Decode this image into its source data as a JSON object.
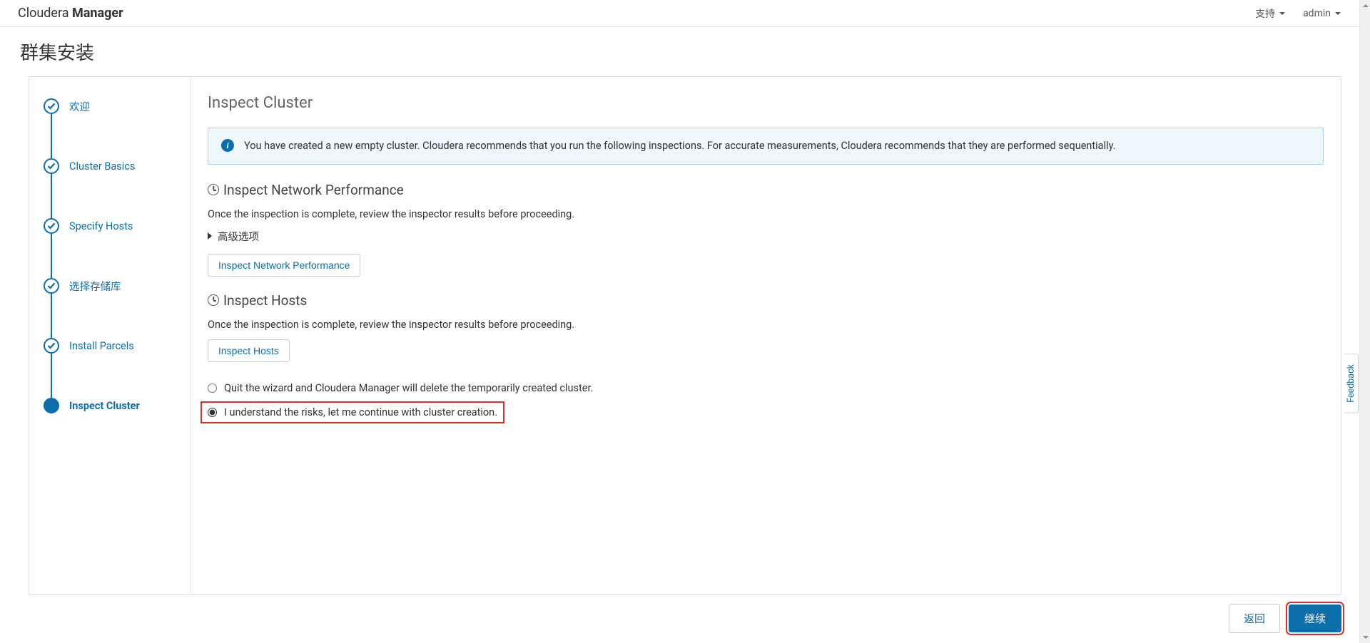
{
  "header": {
    "brand_light": "Cloudera ",
    "brand_bold": "Manager",
    "support": "支持",
    "user": "admin"
  },
  "page_title": "群集安装",
  "sidebar": {
    "steps": [
      {
        "label": "欢迎",
        "done": true,
        "active": false
      },
      {
        "label": "Cluster Basics",
        "done": true,
        "active": false
      },
      {
        "label": "Specify Hosts",
        "done": true,
        "active": false
      },
      {
        "label": "选择存储库",
        "done": true,
        "active": false
      },
      {
        "label": "Install Parcels",
        "done": true,
        "active": false
      },
      {
        "label": "Inspect Cluster",
        "done": false,
        "active": true
      }
    ]
  },
  "main": {
    "title": "Inspect Cluster",
    "alert": "You have created a new empty cluster. Cloudera recommends that you run the following inspections. For accurate measurements, Cloudera recommends that they are performed sequentially.",
    "section_network": {
      "title": "Inspect Network Performance",
      "desc": "Once the inspection is complete, review the inspector results before proceeding.",
      "adv": "高级选项",
      "button": "Inspect Network Performance"
    },
    "section_hosts": {
      "title": "Inspect Hosts",
      "desc": "Once the inspection is complete, review the inspector results before proceeding.",
      "button": "Inspect Hosts"
    },
    "radios": {
      "opt1": "Quit the wizard and Cloudera Manager will delete the temporarily created cluster.",
      "opt2": "I understand the risks, let me continue with cluster creation."
    }
  },
  "footer": {
    "back": "返回",
    "continue": "继续"
  },
  "feedback_tab": "Feedback"
}
